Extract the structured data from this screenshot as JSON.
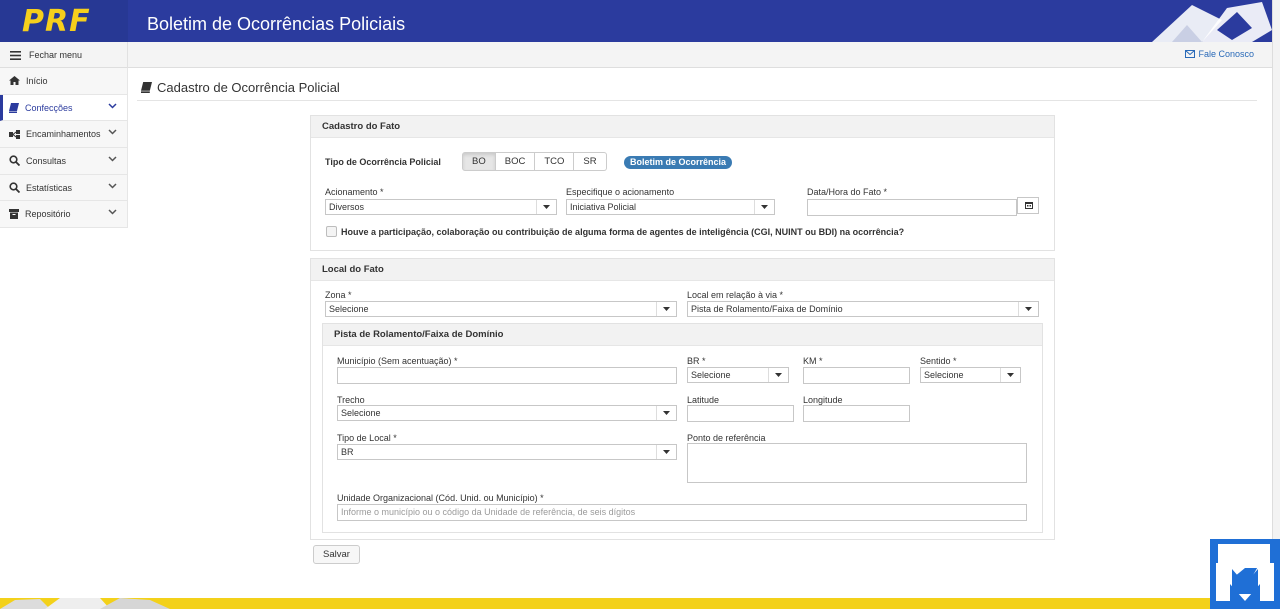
{
  "header": {
    "logo": "PRF",
    "title": "Boletim de Ocorrências Policiais"
  },
  "topbar": {
    "menu_toggle": "Fechar menu",
    "contact": "Fale Conosco"
  },
  "sidebar": {
    "items": [
      {
        "label": "Início",
        "icon": "home-icon"
      },
      {
        "label": "Confecções",
        "icon": "book-icon",
        "active": true
      },
      {
        "label": "Encaminhamentos",
        "icon": "share-icon"
      },
      {
        "label": "Consultas",
        "icon": "search-icon"
      },
      {
        "label": "Estatísticas",
        "icon": "search-icon"
      },
      {
        "label": "Repositório",
        "icon": "archive-icon"
      }
    ]
  },
  "page": {
    "title": "Cadastro de Ocorrência Policial"
  },
  "fato": {
    "heading": "Cadastro do Fato",
    "tipo_label": "Tipo de Ocorrência Policial",
    "tipos": [
      "BO",
      "BOC",
      "TCO",
      "SR"
    ],
    "tipo_selected": "BO",
    "badge": "Boletim de Ocorrência",
    "acionamento_label": "Acionamento *",
    "acionamento_value": "Diversos",
    "especifique_label": "Especifique o acionamento",
    "especifique_value": "Iniciativa Policial",
    "datahora_label": "Data/Hora do Fato *",
    "datahora_value": "",
    "inteligencia_label": "Houve a participação, colaboração ou contribuição de alguma forma de agentes de inteligência (CGI, NUINT ou BDI) na ocorrência?"
  },
  "local": {
    "heading": "Local do Fato",
    "zona_label": "Zona *",
    "zona_value": "Selecione",
    "relacao_label": "Local em relação à via *",
    "relacao_value": "Pista de Rolamento/Faixa de Domínio",
    "pista": {
      "heading": "Pista de Rolamento/Faixa de Domínio",
      "municipio_label": "Município (Sem acentuação) *",
      "br_label": "BR *",
      "br_value": "Selecione",
      "km_label": "KM *",
      "sentido_label": "Sentido *",
      "sentido_value": "Selecione",
      "trecho_label": "Trecho",
      "trecho_value": "Selecione",
      "latitude_label": "Latitude",
      "longitude_label": "Longitude",
      "tipo_local_label": "Tipo de Local *",
      "tipo_local_value": "BR",
      "ponto_label": "Ponto de referência",
      "unidade_label": "Unidade Organizacional (Cód. Unid. ou Município) *",
      "unidade_placeholder": "Informe o município ou o código da Unidade de referência, de seis dígitos"
    }
  },
  "actions": {
    "save": "Salvar"
  },
  "colors": {
    "header": "#2b3b9e",
    "logo": "#f6cf1c",
    "badge": "#3a7bb3",
    "footer": "#f3d11a",
    "link": "#2a6ab8"
  }
}
